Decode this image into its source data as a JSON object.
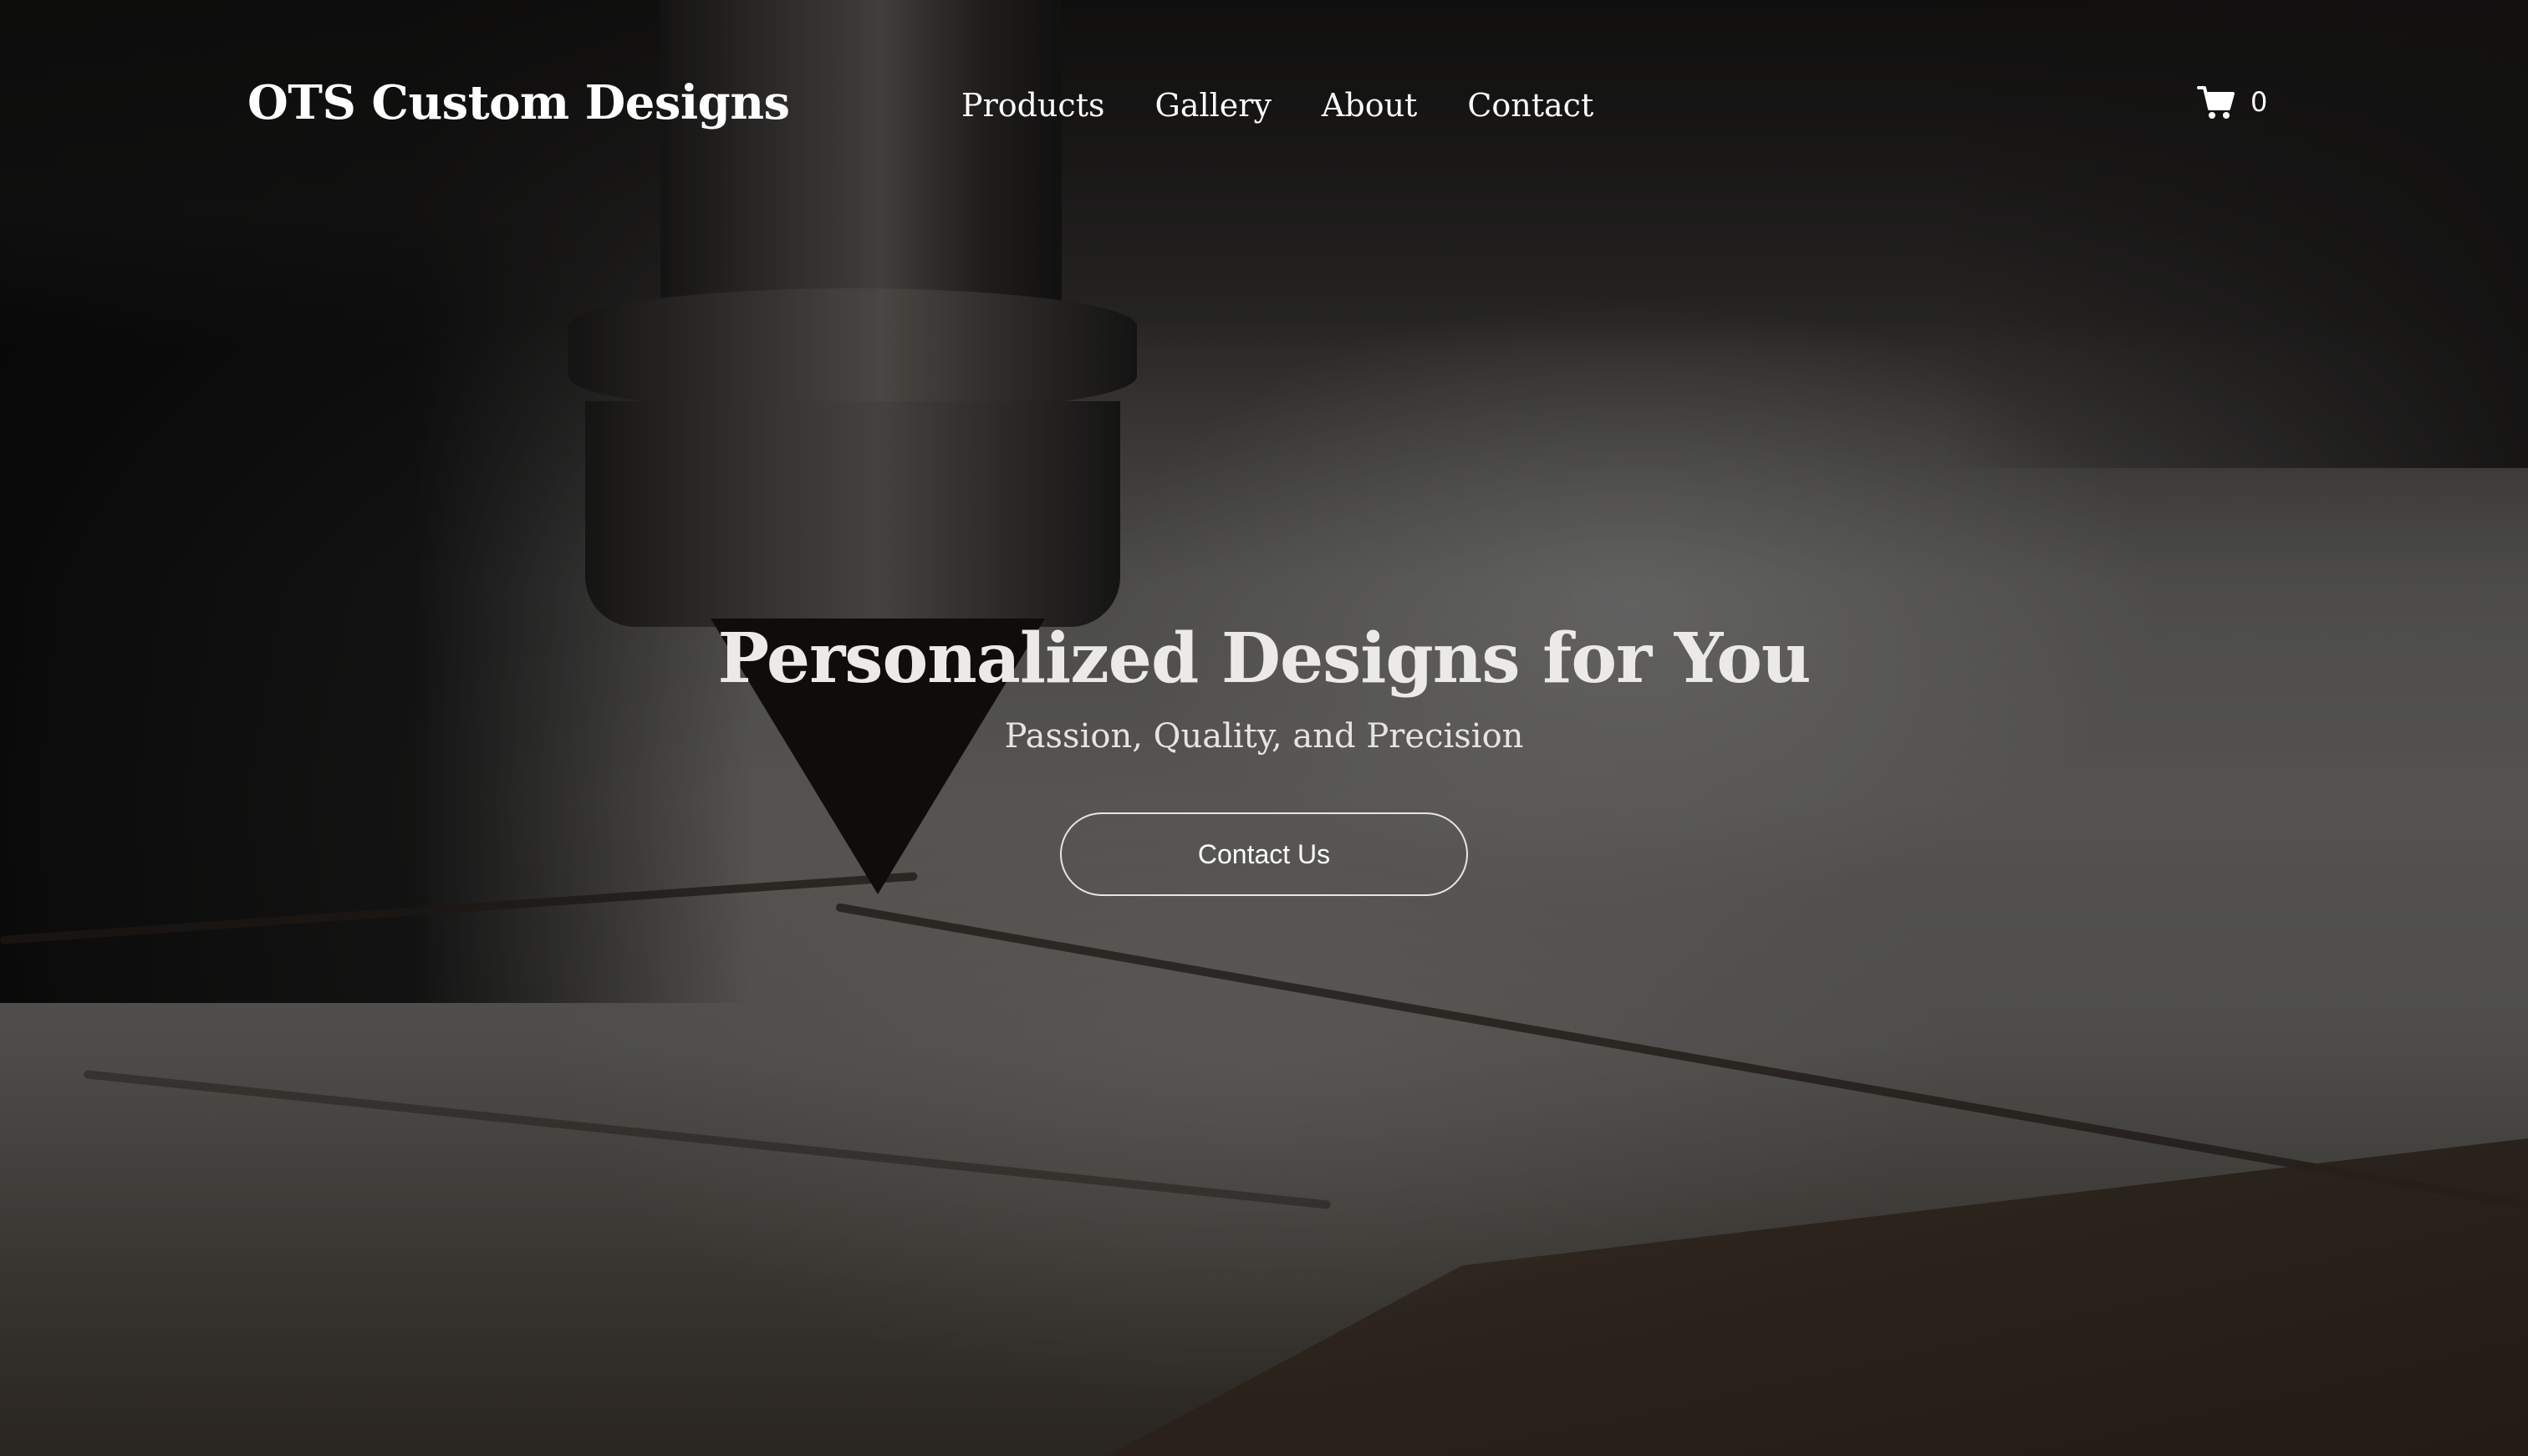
{
  "brand": {
    "name": "OTS Custom Designs"
  },
  "nav": {
    "items": [
      {
        "label": "Products"
      },
      {
        "label": "Gallery"
      },
      {
        "label": "About"
      },
      {
        "label": "Contact"
      }
    ]
  },
  "cart": {
    "icon": "shopping-cart-icon",
    "count": "0"
  },
  "hero": {
    "title": "Personalized Designs for You",
    "tagline": "Passion, Quality, and Precision",
    "cta_label": "Contact Us"
  },
  "colors": {
    "text": "#ffffff",
    "overlay": "#000000",
    "button_border": "#e8e6e2"
  }
}
